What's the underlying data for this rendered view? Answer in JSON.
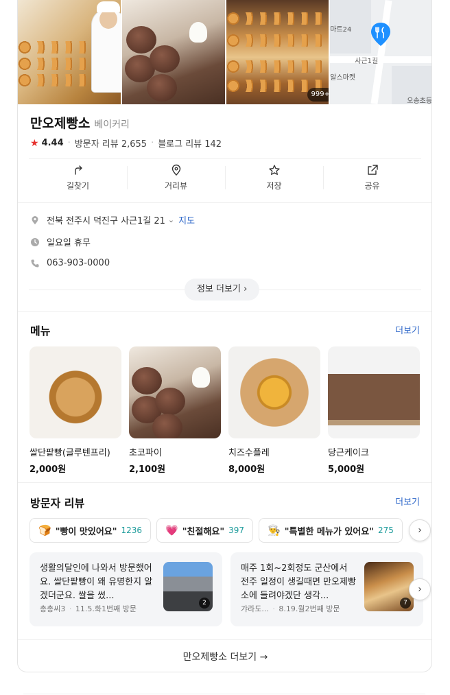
{
  "place": {
    "name": "만오제빵소",
    "category": "베이커리",
    "rating": "4.44",
    "visitor_reviews": "방문자 리뷰 2,655",
    "blog_reviews": "블로그 리뷰 142",
    "photo_count": "999+"
  },
  "map": {
    "labels": [
      "마트24",
      "사근1길",
      "알스마켓",
      "오송초등학"
    ]
  },
  "actions": [
    {
      "label": "길찾기",
      "icon": "directions-icon"
    },
    {
      "label": "거리뷰",
      "icon": "streetview-icon"
    },
    {
      "label": "저장",
      "icon": "star-outline-icon"
    },
    {
      "label": "공유",
      "icon": "share-icon"
    }
  ],
  "info": {
    "address": "전북 전주시 덕진구 사근1길 21",
    "map_link": "지도",
    "hours": "일요일 휴무",
    "phone": "063-903-0000",
    "more_info": "정보 더보기"
  },
  "menu": {
    "title": "메뉴",
    "more": "더보기",
    "items": [
      {
        "name": "쌀단팥빵(글루텐프리)",
        "price": "2,000원"
      },
      {
        "name": "초코파이",
        "price": "2,100원"
      },
      {
        "name": "치즈수플레",
        "price": "8,000원"
      },
      {
        "name": "당근케이크",
        "price": "5,000원"
      }
    ]
  },
  "reviews": {
    "title": "방문자 리뷰",
    "more": "더보기",
    "keywords": [
      {
        "emoji": "🍞",
        "text": "\"빵이 맛있어요\"",
        "count": "1236"
      },
      {
        "emoji": "💗",
        "text": "\"친절해요\"",
        "count": "397"
      },
      {
        "emoji": "👨‍🍳",
        "text": "\"특별한 메뉴가 있어요\"",
        "count": "275"
      }
    ],
    "items": [
      {
        "text": "생활의달인에 나와서 방문했어요. 쌀단팥빵이 왜 유명한지 알겠더군요. 쌀을 썼...",
        "author": "총총씨3",
        "meta": "11.5.화1번째 방문",
        "photo_count": "2"
      },
      {
        "text": "매주 1회~2회정도 군산에서 전주 일정이 생길때면 만오제빵소에 들려야겠단 생각...",
        "author": "갸라도...",
        "meta": "8.19.월2번째 방문",
        "photo_count": "7"
      }
    ]
  },
  "footer": {
    "more": "만오제빵소 더보기 →"
  },
  "colors": {
    "accent": "#2a64c8",
    "star": "#e6312e",
    "count": "#1a9a9a"
  }
}
